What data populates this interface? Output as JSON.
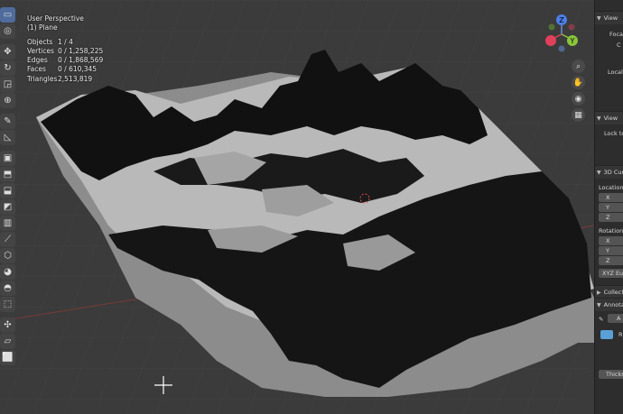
{
  "viewport": {
    "title": "User Perspective",
    "subtitle": "(1) Plane",
    "stats": [
      {
        "label": "Objects",
        "value": "1 / 4"
      },
      {
        "label": "Vertices",
        "value": "0 / 1,258,225"
      },
      {
        "label": "Edges",
        "value": "0 / 1,868,569"
      },
      {
        "label": "Faces",
        "value": "0 / 610,345"
      },
      {
        "label": "Triangles",
        "value": "2,513,819"
      }
    ],
    "gizmo": {
      "z": "Z",
      "y": "Y",
      "x": "X"
    },
    "nav_icons": [
      "zoom-icon",
      "pan-hand-icon",
      "camera-icon",
      "grid-icon"
    ]
  },
  "toolbar": {
    "tools": [
      {
        "name": "select-box-icon",
        "glyph": "▭",
        "active": true
      },
      {
        "name": "cursor-icon",
        "glyph": "◎"
      },
      {
        "name": "move-icon",
        "glyph": "✥"
      },
      {
        "name": "rotate-icon",
        "glyph": "↻"
      },
      {
        "name": "scale-icon",
        "glyph": "◲"
      },
      {
        "name": "transform-icon",
        "glyph": "⊕"
      },
      {
        "name": "annotate-icon",
        "glyph": "✎"
      },
      {
        "name": "measure-icon",
        "glyph": "◺"
      },
      {
        "name": "add-cube-icon",
        "glyph": "▣"
      },
      {
        "name": "extrude-icon",
        "glyph": "⬒"
      },
      {
        "name": "inset-icon",
        "glyph": "⬓"
      },
      {
        "name": "bevel-icon",
        "glyph": "◩"
      },
      {
        "name": "loop-cut-icon",
        "glyph": "▥"
      },
      {
        "name": "knife-icon",
        "glyph": "⟋"
      },
      {
        "name": "poly-build-icon",
        "glyph": "⬡"
      },
      {
        "name": "spin-icon",
        "glyph": "◕"
      },
      {
        "name": "smooth-icon",
        "glyph": "◓"
      },
      {
        "name": "edge-slide-icon",
        "glyph": "⬚"
      },
      {
        "name": "shrink-icon",
        "glyph": "✣"
      },
      {
        "name": "shear-icon",
        "glyph": "▱"
      },
      {
        "name": "rip-icon",
        "glyph": "⬜"
      }
    ]
  },
  "panel": {
    "view_header": "View",
    "focal_label": "Focal",
    "clip_label": "C",
    "local_label": "Local",
    "view_lock_header": "View",
    "lock_label": "Lock to",
    "cursor_header": "3D Cur",
    "location_label": "Location:",
    "rotation_label": "Rotation:",
    "x": "X",
    "y": "Y",
    "z": "Z",
    "rotation_mode": "XYZ Eul",
    "collections_header": "Collect",
    "annotations_header": "Annota",
    "annotation_item": "A",
    "layer_label": "R",
    "thickness_label": "Thickn"
  }
}
